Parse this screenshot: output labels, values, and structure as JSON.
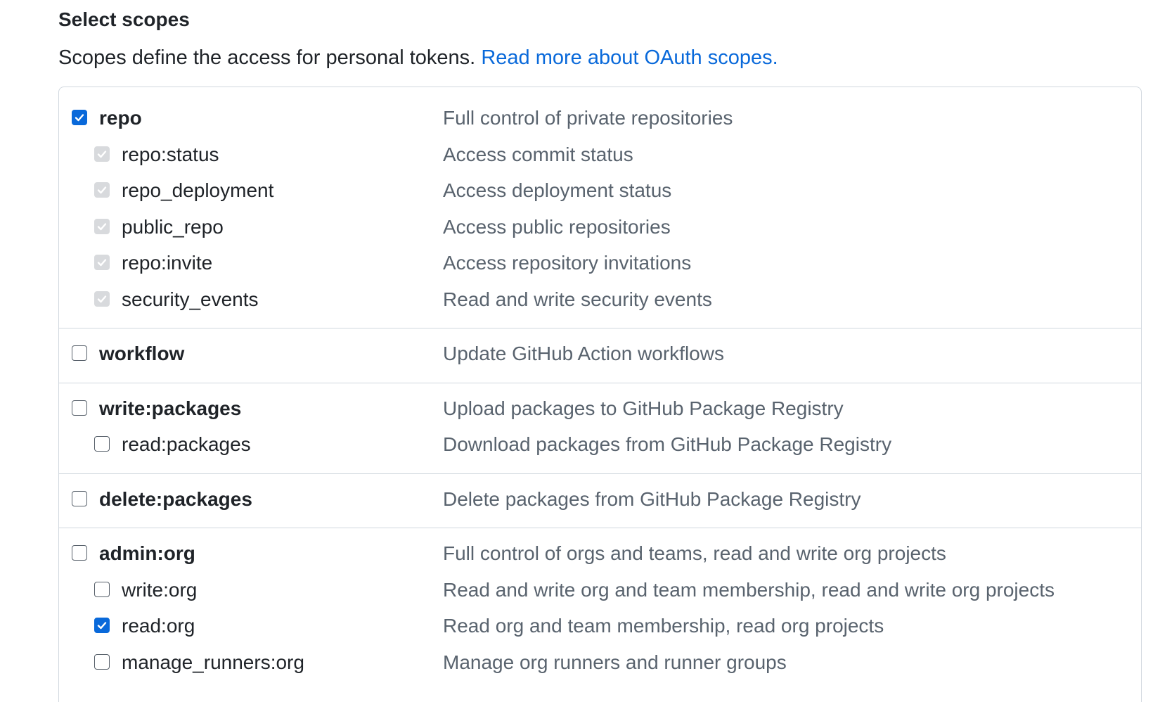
{
  "heading": "Select scopes",
  "intro": {
    "text": "Scopes define the access for personal tokens.",
    "link": "Read more about OAuth scopes."
  },
  "colors": {
    "accent": "#0969da",
    "border": "#d0d7de",
    "muted_text": "#59636e",
    "disabled_check": "#d8dadd"
  },
  "groups": [
    {
      "parent": {
        "name": "repo",
        "description": "Full control of private repositories",
        "checked": true
      },
      "children": [
        {
          "name": "repo:status",
          "description": "Access commit status",
          "checked": true,
          "disabled": true
        },
        {
          "name": "repo_deployment",
          "description": "Access deployment status",
          "checked": true,
          "disabled": true
        },
        {
          "name": "public_repo",
          "description": "Access public repositories",
          "checked": true,
          "disabled": true
        },
        {
          "name": "repo:invite",
          "description": "Access repository invitations",
          "checked": true,
          "disabled": true
        },
        {
          "name": "security_events",
          "description": "Read and write security events",
          "checked": true,
          "disabled": true
        }
      ]
    },
    {
      "parent": {
        "name": "workflow",
        "description": "Update GitHub Action workflows",
        "checked": false
      },
      "children": []
    },
    {
      "parent": {
        "name": "write:packages",
        "description": "Upload packages to GitHub Package Registry",
        "checked": false
      },
      "children": [
        {
          "name": "read:packages",
          "description": "Download packages from GitHub Package Registry",
          "checked": false,
          "disabled": false
        }
      ]
    },
    {
      "parent": {
        "name": "delete:packages",
        "description": "Delete packages from GitHub Package Registry",
        "checked": false
      },
      "children": []
    },
    {
      "parent": {
        "name": "admin:org",
        "description": "Full control of orgs and teams, read and write org projects",
        "checked": false
      },
      "children": [
        {
          "name": "write:org",
          "description": "Read and write org and team membership, read and write org projects",
          "checked": false,
          "disabled": false
        },
        {
          "name": "read:org",
          "description": "Read org and team membership, read org projects",
          "checked": true,
          "disabled": false
        },
        {
          "name": "manage_runners:org",
          "description": "Manage org runners and runner groups",
          "checked": false,
          "disabled": false
        }
      ]
    }
  ]
}
